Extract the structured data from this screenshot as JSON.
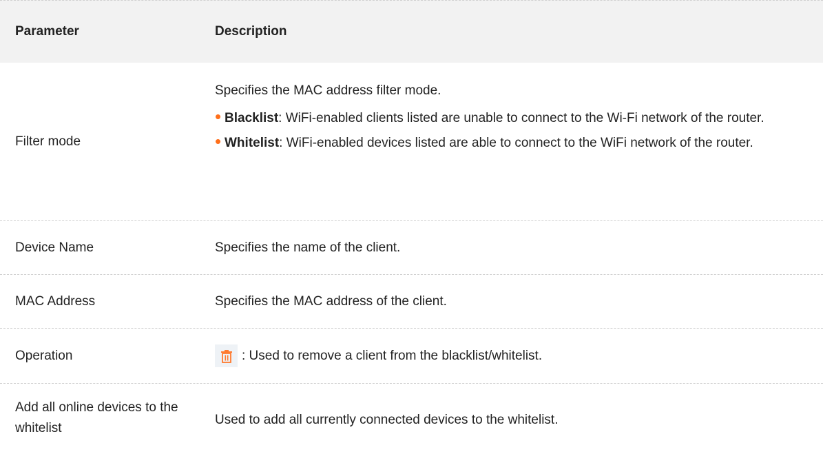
{
  "table": {
    "headers": {
      "parameter": "Parameter",
      "description": "Description"
    },
    "filter_mode": {
      "param": "Filter mode",
      "intro": "Specifies the MAC address filter mode.",
      "blacklist_term": "Blacklist",
      "blacklist_text": ": WiFi-enabled clients listed are unable to connect to the Wi-Fi network of the router.",
      "whitelist_term": "Whitelist",
      "whitelist_text": ": WiFi-enabled devices listed are able to connect to the WiFi network of the router."
    },
    "device_name": {
      "param": "Device Name",
      "desc": "Specifies the name of the client."
    },
    "mac_address": {
      "param": "MAC Address",
      "desc": "Specifies the MAC address of the client."
    },
    "operation": {
      "param": "Operation",
      "icon": "trash-icon",
      "desc": ": Used to remove a client from the blacklist/whitelist."
    },
    "add_all": {
      "param": "Add all online devices to the whitelist",
      "desc": "Used to add all currently connected devices to the whitelist."
    }
  },
  "colors": {
    "header_bg": "#f2f2f2",
    "bullet": "#ff6f1a",
    "icon": "#ff7a2e",
    "border": "#cfcfcf"
  }
}
